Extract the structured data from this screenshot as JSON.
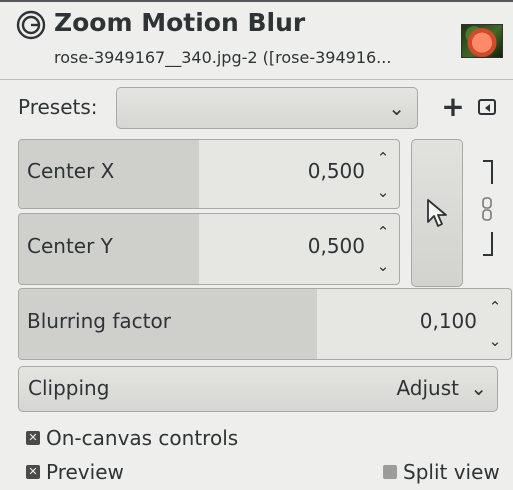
{
  "header": {
    "title": "Zoom Motion Blur",
    "subtitle": "rose-3949167__340.jpg-2 ([rose-394916..."
  },
  "presets": {
    "label": "Presets:",
    "value": "",
    "add_icon": "plus-icon",
    "menu_icon": "menu-left-icon"
  },
  "center_x": {
    "label": "Center X",
    "value": "0,500"
  },
  "center_y": {
    "label": "Center Y",
    "value": "0,500"
  },
  "blurring": {
    "label": "Blurring factor",
    "value": "0,100"
  },
  "clipping": {
    "label": "Clipping",
    "value": "Adjust"
  },
  "options": {
    "on_canvas": {
      "label": "On-canvas controls",
      "checked": true
    },
    "preview": {
      "label": "Preview",
      "checked": true
    },
    "split_view": {
      "label": "Split view",
      "checked": false
    }
  },
  "icons": {
    "spin_up": "⌃",
    "spin_down": "⌄",
    "combo_arrow": "⌄",
    "plus": "+",
    "check": "✕"
  }
}
